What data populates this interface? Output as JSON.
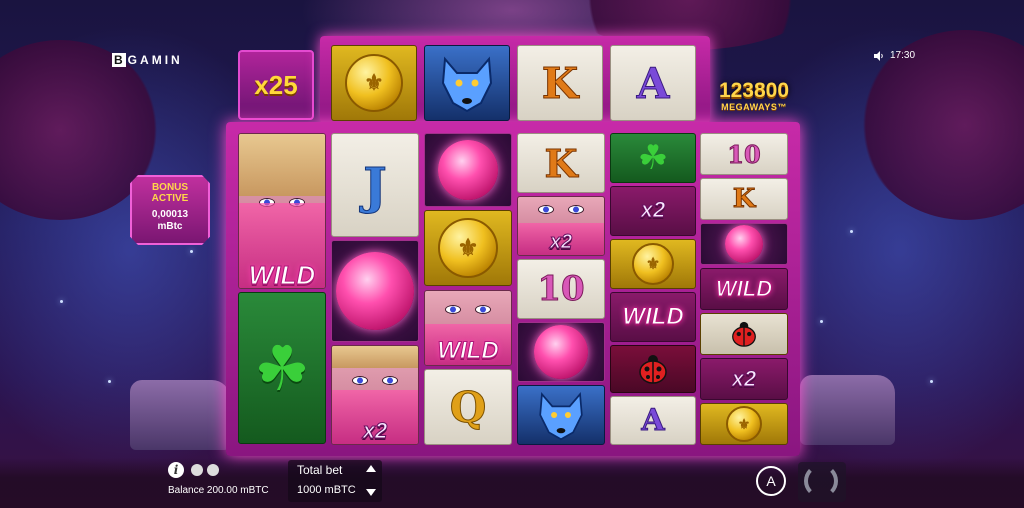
{
  "brand": {
    "logo_letters": [
      "B",
      "G",
      "A",
      "M",
      "I",
      "N",
      "G"
    ]
  },
  "status": {
    "time": "17:30"
  },
  "multiplier": {
    "label": "x25"
  },
  "megaways": {
    "count": "123800",
    "label": "MEGAWAYS™"
  },
  "bonus": {
    "line1": "BONUS",
    "line2": "ACTIVE",
    "amount": "0,00013",
    "unit": "mBtc"
  },
  "reels": {
    "top_row": [
      "coin",
      "wolf",
      "K",
      "A"
    ],
    "columns": [
      [
        "wild-face",
        "clover"
      ],
      [
        "J",
        "orb",
        "face-x2"
      ],
      [
        "orb",
        "coin",
        "wild-face",
        "Q"
      ],
      [
        "K",
        "face-x2",
        "10",
        "orb",
        "wolf"
      ],
      [
        "clover",
        "x2",
        "coin",
        "wild",
        "ladybug",
        "A"
      ],
      [
        "10",
        "K",
        "orb",
        "wild",
        "ladybug",
        "x2",
        "coin"
      ]
    ],
    "wild_text": "WILD",
    "x2_text": "x2"
  },
  "footer": {
    "balance": "Balance 200.00 mBTC",
    "total_bet_label": "Total bet",
    "total_bet_value": "1000 mBTC",
    "auto_label": "A"
  },
  "colors": {
    "frame": "#c72aa8",
    "accent_gold": "#ffd64a",
    "background": "#1a1440"
  }
}
